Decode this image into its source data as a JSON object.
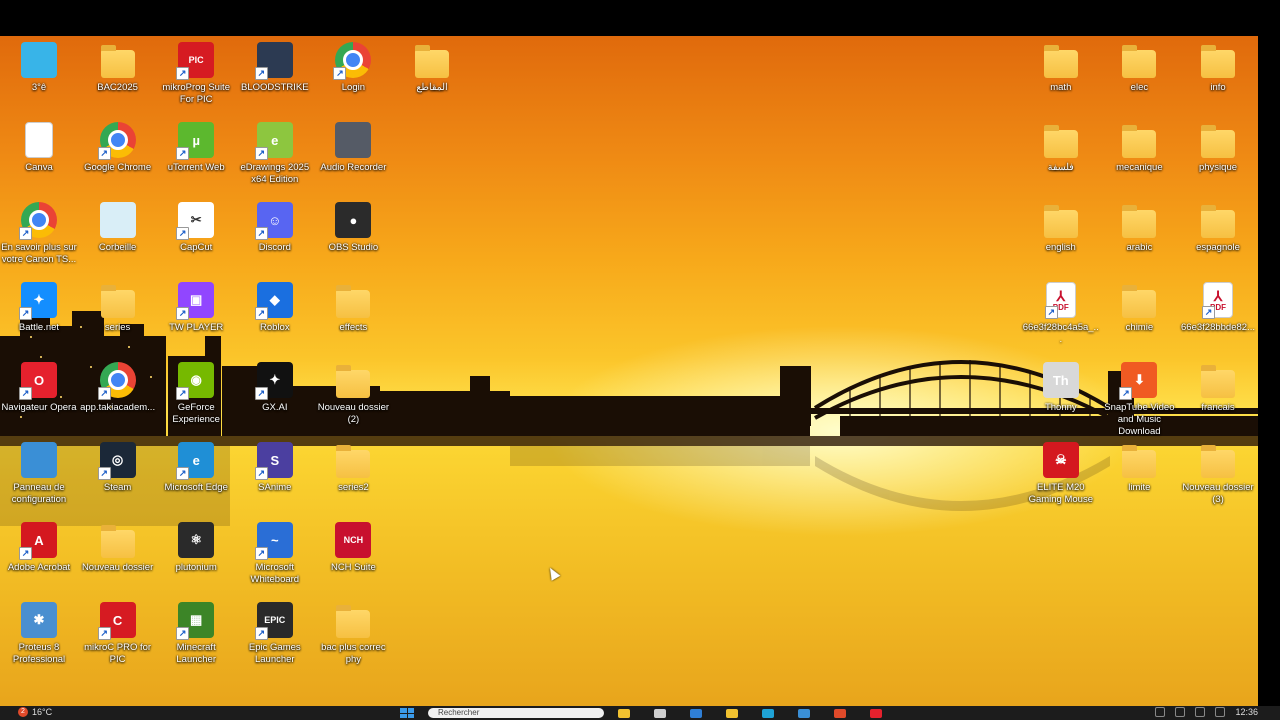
{
  "desktop": {
    "icons": [
      {
        "label": "3°ê",
        "icon": "monitor-icon",
        "type": "app",
        "color": "#38b4e8"
      },
      {
        "label": "BAC2025",
        "icon": "folder-icon",
        "type": "folder"
      },
      {
        "label": "mikroProg Suite For PIC",
        "icon": "pic-icon",
        "type": "shortcut",
        "color": "#d61b22",
        "text": "PIC"
      },
      {
        "label": "BLOODSTRIKE",
        "icon": "bloodstrike-icon",
        "type": "shortcut",
        "color": "#2c3a52"
      },
      {
        "label": "Login",
        "icon": "chrome-icon",
        "type": "shortcut",
        "color": "#ffffff"
      },
      {
        "label": "المقاطع",
        "icon": "folder-icon",
        "type": "folder"
      },
      {
        "label": "Canva",
        "icon": "document-icon",
        "type": "doc"
      },
      {
        "label": "Google Chrome",
        "icon": "chrome-icon",
        "type": "shortcut",
        "color": "#ffffff"
      },
      {
        "label": "uTorrent Web",
        "icon": "utorrent-icon",
        "type": "shortcut",
        "color": "#5cb82e",
        "text": "µ"
      },
      {
        "label": "eDrawings 2025 x64 Edition",
        "icon": "edrawings-icon",
        "type": "shortcut",
        "color": "#8dc63f",
        "text": "e"
      },
      {
        "label": "Audio Recorder",
        "icon": "microphone-icon",
        "type": "app",
        "color": "#555b66"
      },
      {
        "label": "En savoir plus sur votre Canon TS...",
        "icon": "chrome-icon",
        "type": "shortcut",
        "color": "#ffffff"
      },
      {
        "label": "Corbeille",
        "icon": "recycle-bin-icon",
        "type": "app",
        "color": "#d9eef7"
      },
      {
        "label": "CapCut",
        "icon": "capcut-icon",
        "type": "shortcut",
        "color": "#ffffff",
        "text": "✂"
      },
      {
        "label": "Discord",
        "icon": "discord-icon",
        "type": "shortcut",
        "color": "#5865f2",
        "text": "☺"
      },
      {
        "label": "OBS Studio",
        "icon": "obs-icon",
        "type": "app",
        "color": "#2b2b2b",
        "text": "●"
      },
      {
        "label": "Battle.net",
        "icon": "battlenet-icon",
        "type": "shortcut",
        "color": "#148eff",
        "text": "✦"
      },
      {
        "label": "series",
        "icon": "folder-icon",
        "type": "folder"
      },
      {
        "label": "TW PLAYER",
        "icon": "twitch-icon",
        "type": "shortcut",
        "color": "#9146ff",
        "text": "▣"
      },
      {
        "label": "Roblox",
        "icon": "roblox-icon",
        "type": "shortcut",
        "color": "#1a6fe0",
        "text": "◆"
      },
      {
        "label": "effects",
        "icon": "folder-icon",
        "type": "folder"
      },
      {
        "label": "Navigateur Opera",
        "icon": "opera-icon",
        "type": "shortcut",
        "color": "#e5212d",
        "text": "O"
      },
      {
        "label": "app.takiacadem...",
        "icon": "chrome-icon",
        "type": "shortcut",
        "color": "#ffffff"
      },
      {
        "label": "GeForce Experience",
        "icon": "nvidia-icon",
        "type": "shortcut",
        "color": "#76b900",
        "text": "◉"
      },
      {
        "label": "GX.AI",
        "icon": "gxai-icon",
        "type": "shortcut",
        "color": "#111111",
        "text": "✦"
      },
      {
        "label": "Nouveau dossier (2)",
        "icon": "folder-icon",
        "type": "folder"
      },
      {
        "label": "Panneau de configuration",
        "icon": "control-panel-icon",
        "type": "app",
        "color": "#3a8fd6"
      },
      {
        "label": "Steam",
        "icon": "steam-icon",
        "type": "shortcut",
        "color": "#1b2838",
        "text": "◎"
      },
      {
        "label": "Microsoft Edge",
        "icon": "edge-icon",
        "type": "shortcut",
        "color": "#1f8fd6",
        "text": "e"
      },
      {
        "label": "SAnime",
        "icon": "sanime-icon",
        "type": "shortcut",
        "color": "#4b3fa0",
        "text": "S"
      },
      {
        "label": "series2",
        "icon": "folder-icon",
        "type": "folder"
      },
      {
        "label": "Adobe Acrobat",
        "icon": "acrobat-icon",
        "type": "shortcut",
        "color": "#d4181f",
        "text": "A"
      },
      {
        "label": "Nouveau dossier",
        "icon": "folder-icon",
        "type": "folder"
      },
      {
        "label": "plutonium",
        "icon": "plutonium-icon",
        "type": "app",
        "color": "#2a2a2a",
        "text": "⚛"
      },
      {
        "label": "Microsoft Whiteboard",
        "icon": "whiteboard-icon",
        "type": "shortcut",
        "color": "#2a6ed6",
        "text": "~"
      },
      {
        "label": "NCH Suite",
        "icon": "nch-icon",
        "type": "app",
        "color": "#c8102e",
        "text": "NCH"
      },
      {
        "label": "Proteus 8 Professional",
        "icon": "proteus-icon",
        "type": "app",
        "color": "#4a8fd0",
        "text": "✱"
      },
      {
        "label": "mikroC PRO for PIC",
        "icon": "mikroc-icon",
        "type": "shortcut",
        "color": "#d61b22",
        "text": "C"
      },
      {
        "label": "Minecraft Launcher",
        "icon": "minecraft-icon",
        "type": "shortcut",
        "color": "#3c8527",
        "text": "▦"
      },
      {
        "label": "Epic Games Launcher",
        "icon": "epic-games-icon",
        "type": "shortcut",
        "color": "#2a2a2a",
        "text": "EPIC"
      },
      {
        "label": "bac plus correc phy",
        "icon": "folder-icon",
        "type": "folder"
      },
      {
        "label": "math",
        "icon": "folder-icon",
        "type": "folder"
      },
      {
        "label": "elec",
        "icon": "folder-icon",
        "type": "folder"
      },
      {
        "label": "info",
        "icon": "folder-icon",
        "type": "folder"
      },
      {
        "label": "فلسفة",
        "icon": "folder-icon",
        "type": "folder"
      },
      {
        "label": "mecanique",
        "icon": "folder-icon",
        "type": "folder"
      },
      {
        "label": "physique",
        "icon": "folder-icon",
        "type": "folder"
      },
      {
        "label": "english",
        "icon": "folder-icon",
        "type": "folder"
      },
      {
        "label": "arabic",
        "icon": "folder-icon",
        "type": "folder"
      },
      {
        "label": "espagnole",
        "icon": "folder-icon",
        "type": "folder"
      },
      {
        "label": "66e3f28bc4a5a_...",
        "icon": "pdf-icon",
        "type": "pdf"
      },
      {
        "label": "chimie",
        "icon": "folder-icon",
        "type": "folder"
      },
      {
        "label": "66e3f28bbde82...",
        "icon": "pdf-icon",
        "type": "pdf"
      },
      {
        "label": "Thonny",
        "icon": "thonny-icon",
        "type": "app",
        "color": "#d8d8d8",
        "text": "Th"
      },
      {
        "label": "SnapTube Video and Music Download",
        "icon": "snaptube-icon",
        "type": "shortcut",
        "color": "#f05a22",
        "text": "⬇"
      },
      {
        "label": "francais",
        "icon": "folder-icon",
        "type": "folder"
      },
      {
        "label": "ELITE M20 Gaming Mouse",
        "icon": "skull-icon",
        "type": "app",
        "color": "#d4181f",
        "text": "☠"
      },
      {
        "label": "limite",
        "icon": "folder-icon",
        "type": "folder"
      },
      {
        "label": "Nouveau dossier (3)",
        "icon": "folder-icon",
        "type": "folder"
      }
    ]
  },
  "taskbar": {
    "weather_badge": "2",
    "weather_temp": "16°C",
    "search_placeholder": "Rechercher",
    "time": "12:36",
    "apps": [
      {
        "name": "file-explorer-icon",
        "color": "#f2c230"
      },
      {
        "name": "task-view-icon",
        "color": "#cfcfcf"
      },
      {
        "name": "vscode-icon",
        "color": "#2f7fd6"
      },
      {
        "name": "folder-icon",
        "color": "#f2c230"
      },
      {
        "name": "edge-icon",
        "color": "#1fa3d6"
      },
      {
        "name": "store-icon",
        "color": "#3a8fd6"
      },
      {
        "name": "chrome-icon",
        "color": "#e04a2a"
      },
      {
        "name": "opera-icon",
        "color": "#e5212d"
      }
    ]
  }
}
